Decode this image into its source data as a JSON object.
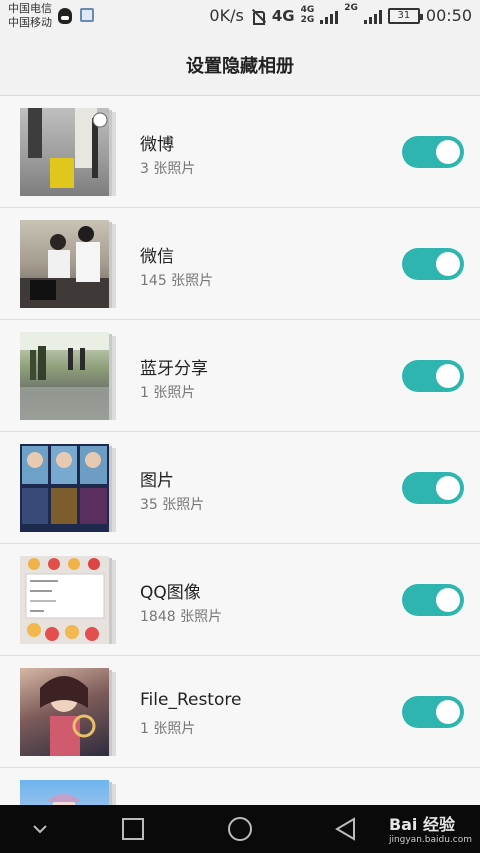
{
  "status_bar": {
    "carrier_1": "中国电信",
    "carrier_2": "中国移动",
    "speed": "0K/s",
    "net_4g": "4G",
    "net_4g_small": "4G",
    "net_2g_small": "2G",
    "net_2g": "2G",
    "battery": "31",
    "time": "00:50"
  },
  "header": {
    "title": "设置隐藏相册"
  },
  "albums": [
    {
      "name": "微博",
      "count": "3 张照片",
      "enabled": true
    },
    {
      "name": "微信",
      "count": "145 张照片",
      "enabled": true
    },
    {
      "name": "蓝牙分享",
      "count": "1 张照片",
      "enabled": true
    },
    {
      "name": "图片",
      "count": "35 张照片",
      "enabled": true
    },
    {
      "name": "QQ图像",
      "count": "1848 张照片",
      "enabled": true
    },
    {
      "name": "File_Restore",
      "count": "1 张照片",
      "enabled": true
    }
  ],
  "nav_bar": {
    "back": "chevron-down-icon",
    "recent": "square-icon",
    "home": "circle-icon",
    "return": "triangle-left-icon"
  },
  "watermark": {
    "brand": "Bai 经验",
    "url": "jingyan.baidu.com"
  },
  "colors": {
    "toggle_on": "#2fb5b0",
    "nav_bg": "#0a0a0a",
    "background": "#f2f2f2"
  }
}
